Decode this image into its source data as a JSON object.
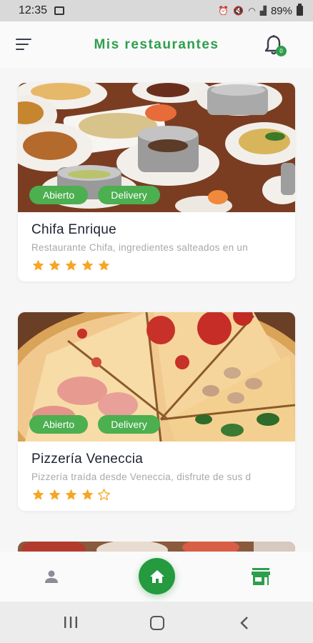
{
  "status_bar": {
    "time": "12:35",
    "battery": "89%"
  },
  "header": {
    "title": "Mis restaurantes",
    "menu_icon": "menu-icon",
    "notification_icon": "bell-icon",
    "notification_count": "0"
  },
  "restaurants": [
    {
      "name": "Chifa Enrique",
      "description": "Restaurante Chifa, ingredientes salteados en un",
      "status": "Abierto",
      "delivery": "Delivery",
      "rating": 5,
      "max_rating": 5
    },
    {
      "name": "Pizzería Veneccia",
      "description": "Pizzería traída desde Veneccia, disfrute de sus d",
      "status": "Abierto",
      "delivery": "Delivery",
      "rating": 4,
      "max_rating": 5
    }
  ],
  "bottom_nav": {
    "items": [
      "profile-icon",
      "home-icon",
      "store-icon"
    ],
    "active": "home-icon"
  },
  "colors": {
    "brand_green": "#2e9e4d",
    "chip_green": "#4caf50",
    "star": "#f5a623",
    "title_text": "#1e2233",
    "muted_text": "#a8a8a8"
  }
}
